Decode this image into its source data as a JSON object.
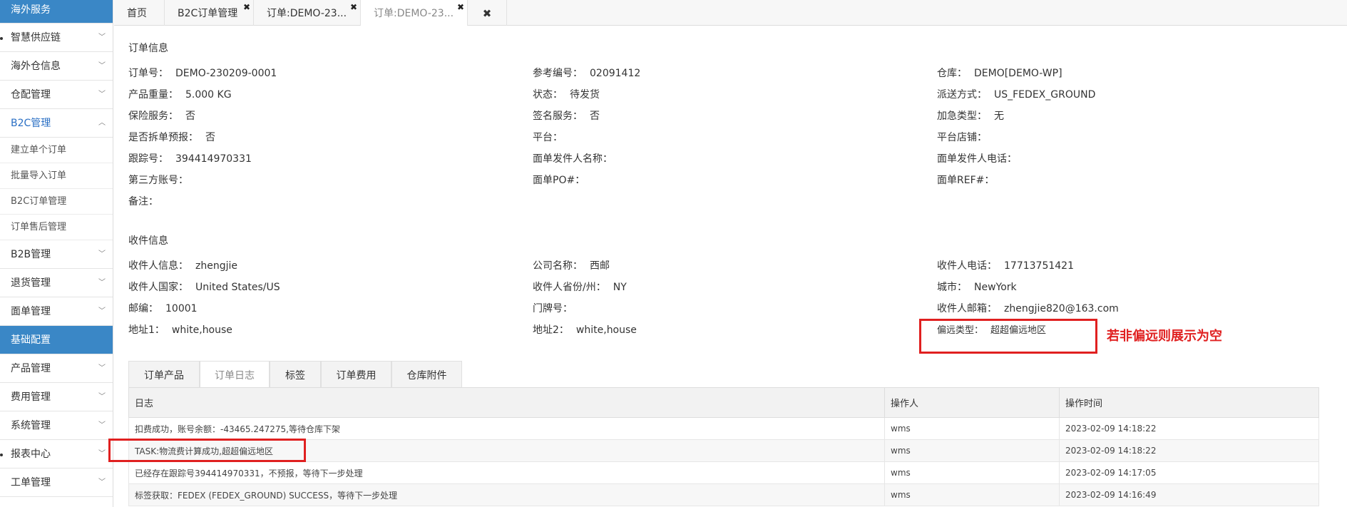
{
  "sidebar": {
    "items": [
      {
        "label": "海外服务",
        "type": "section"
      },
      {
        "label": "智慧供应链",
        "type": "item",
        "chevron": "﹀"
      },
      {
        "label": "海外仓信息",
        "type": "item",
        "chevron": "﹀"
      },
      {
        "label": "仓配管理",
        "type": "item",
        "chevron": "﹀"
      },
      {
        "label": "B2C管理",
        "type": "active",
        "chevron": "︿"
      },
      {
        "label": "建立单个订单",
        "type": "sub"
      },
      {
        "label": "批量导入订单",
        "type": "sub"
      },
      {
        "label": "B2C订单管理",
        "type": "sub"
      },
      {
        "label": "订单售后管理",
        "type": "sub"
      },
      {
        "label": "B2B管理",
        "type": "item",
        "chevron": "﹀"
      },
      {
        "label": "退货管理",
        "type": "item",
        "chevron": "﹀"
      },
      {
        "label": "面单管理",
        "type": "item",
        "chevron": "﹀"
      },
      {
        "label": "基础配置",
        "type": "section"
      },
      {
        "label": "产品管理",
        "type": "item",
        "chevron": "﹀"
      },
      {
        "label": "费用管理",
        "type": "item",
        "chevron": "﹀"
      },
      {
        "label": "系统管理",
        "type": "item",
        "chevron": "﹀"
      },
      {
        "label": "报表中心",
        "type": "item",
        "chevron": "﹀"
      },
      {
        "label": "工单管理",
        "type": "item",
        "chevron": "﹀"
      }
    ]
  },
  "tabs": [
    {
      "label": "首页",
      "close": ""
    },
    {
      "label": "B2C订单管理",
      "close": "✖"
    },
    {
      "label": "订单:DEMO-23...",
      "close": "✖"
    },
    {
      "label": "订单:DEMO-23...",
      "close": "✖"
    }
  ],
  "tab_close_all": "✖",
  "order_info": {
    "title": "订单信息",
    "fields": [
      {
        "label": "订单号：",
        "value": "DEMO-230209-0001"
      },
      {
        "label": "参考编号：",
        "value": "02091412"
      },
      {
        "label": "仓库：",
        "value": "DEMO[DEMO-WP]"
      },
      {
        "label": "产品重量：",
        "value": "5.000 KG"
      },
      {
        "label": "状态：",
        "value": "待发货"
      },
      {
        "label": "派送方式：",
        "value": "US_FEDEX_GROUND"
      },
      {
        "label": "保险服务：",
        "value": "否"
      },
      {
        "label": "签名服务：",
        "value": "否"
      },
      {
        "label": "加急类型：",
        "value": "无"
      },
      {
        "label": "是否拆单预报：",
        "value": "否"
      },
      {
        "label": "平台：",
        "value": ""
      },
      {
        "label": "平台店铺：",
        "value": ""
      },
      {
        "label": "跟踪号：",
        "value": "394414970331"
      },
      {
        "label": "面单发件人名称：",
        "value": ""
      },
      {
        "label": "面单发件人电话：",
        "value": ""
      },
      {
        "label": "第三方账号：",
        "value": ""
      },
      {
        "label": "面单PO#：",
        "value": ""
      },
      {
        "label": "面单REF#：",
        "value": ""
      },
      {
        "label": "备注：",
        "value": ""
      }
    ]
  },
  "receiver_info": {
    "title": "收件信息",
    "fields": [
      {
        "label": "收件人信息：",
        "value": "zhengjie"
      },
      {
        "label": "公司名称：",
        "value": "西邮"
      },
      {
        "label": "收件人电话：",
        "value": "17713751421"
      },
      {
        "label": "收件人国家：",
        "value": "United States/US"
      },
      {
        "label": "收件人省份/州：",
        "value": "NY"
      },
      {
        "label": "城市：",
        "value": "NewYork"
      },
      {
        "label": "邮编：",
        "value": "10001"
      },
      {
        "label": "门牌号：",
        "value": ""
      },
      {
        "label": "收件人邮箱：",
        "value": "zhengjie820@163.com"
      },
      {
        "label": "地址1：",
        "value": "white,house"
      },
      {
        "label": "地址2：",
        "value": "white,house"
      },
      {
        "label": "偏远类型：",
        "value": "超超偏远地区"
      }
    ]
  },
  "annotation": "若非偏远则展示为空",
  "subtabs": [
    "订单产品",
    "订单日志",
    "标签",
    "订单费用",
    "仓库附件"
  ],
  "log": {
    "headers": [
      "日志",
      "操作人",
      "操作时间"
    ],
    "rows": [
      [
        "扣费成功，账号余额：-43465.247275,等待仓库下架",
        "wms",
        "2023-02-09 14:18:22"
      ],
      [
        "TASK:物流费计算成功,超超偏远地区",
        "wms",
        "2023-02-09 14:18:22"
      ],
      [
        "已经存在跟踪号394414970331，不预报，等待下一步处理",
        "wms",
        "2023-02-09 14:17:05"
      ],
      [
        "标签获取：FEDEX (FEDEX_GROUND) SUCCESS，等待下一步处理",
        "wms",
        "2023-02-09 14:16:49"
      ]
    ]
  },
  "colors": {
    "sidebar_section": "#3a87c6",
    "sidebar_active": "#2a6fc4",
    "annotation": "#e02020"
  }
}
